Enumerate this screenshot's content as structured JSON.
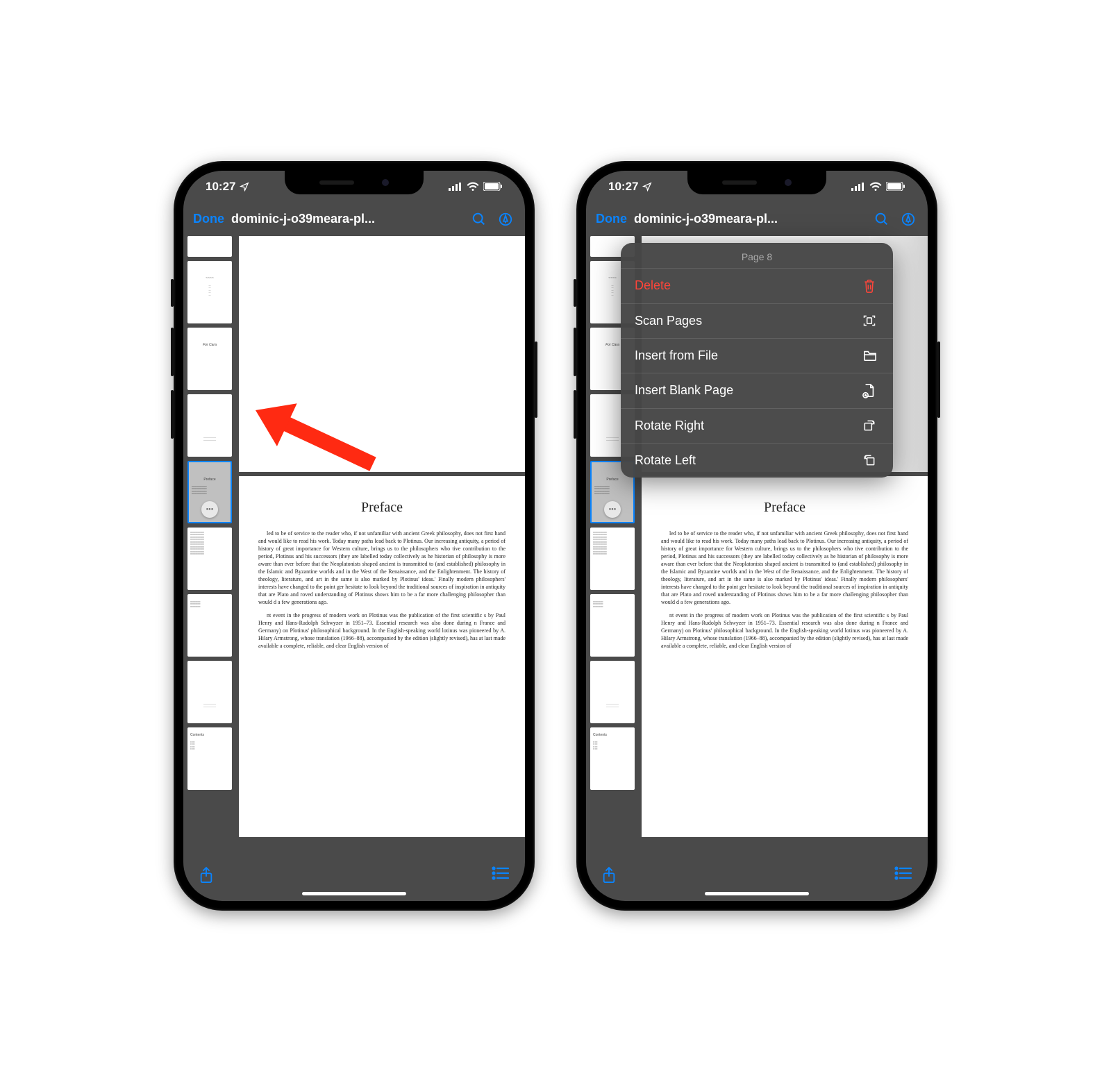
{
  "status": {
    "time": "10:27"
  },
  "nav": {
    "done": "Done",
    "title": "dominic-j-o39meara-pl..."
  },
  "doc": {
    "heading": "Preface",
    "para1": "led to be of service to the reader who, if not unfamiliar with ancient Greek philosophy, does not first hand and would like to read his work. Today many paths lead back to Plotinus. Our increasing antiquity, a period of history of great importance for Western culture, brings us to the philosophers who tive contribution to the period, Plotinus and his successors (they are labelled today collectively as he historian of philosophy is more aware than ever before that the Neoplatonists shaped ancient is transmitted to (and established) philosophy in the Islamic and Byzantine worlds and in the West of the Renaissance, and the Enlightenment. The history of theology, literature, and art in the same is also marked by Plotinus' ideas.' Finally modern philosophers' interests have changed to the point ger hesitate to look beyond the traditional sources of inspiration in antiquity that are Plato and roved understanding of Plotinus shows him to be a far more challenging philosopher than would d a few generations ago.",
    "para2": "nt event in the progress of modern work on Plotinus was the publication of the first scientific s by Paul Henry and Hans-Rudolph Schwyzer in 1951–73. Essential research was also done during n France and Germany) on Plotinus' philosophical background. In the English-speaking world lotinus was pioneered by A. Hilary Armstrong, whose translation (1966–88), accompanied by the edition (slightly revised), has at last made available a complete, reliable, and clear English version of"
  },
  "menu": {
    "header": "Page 8",
    "delete": "Delete",
    "scan": "Scan Pages",
    "insert_file": "Insert from File",
    "insert_blank": "Insert Blank Page",
    "rotate_right": "Rotate Right",
    "rotate_left": "Rotate Left"
  },
  "thumb_labels": {
    "for_cara": "For Cara",
    "preface": "Preface",
    "contents": "Contents"
  }
}
